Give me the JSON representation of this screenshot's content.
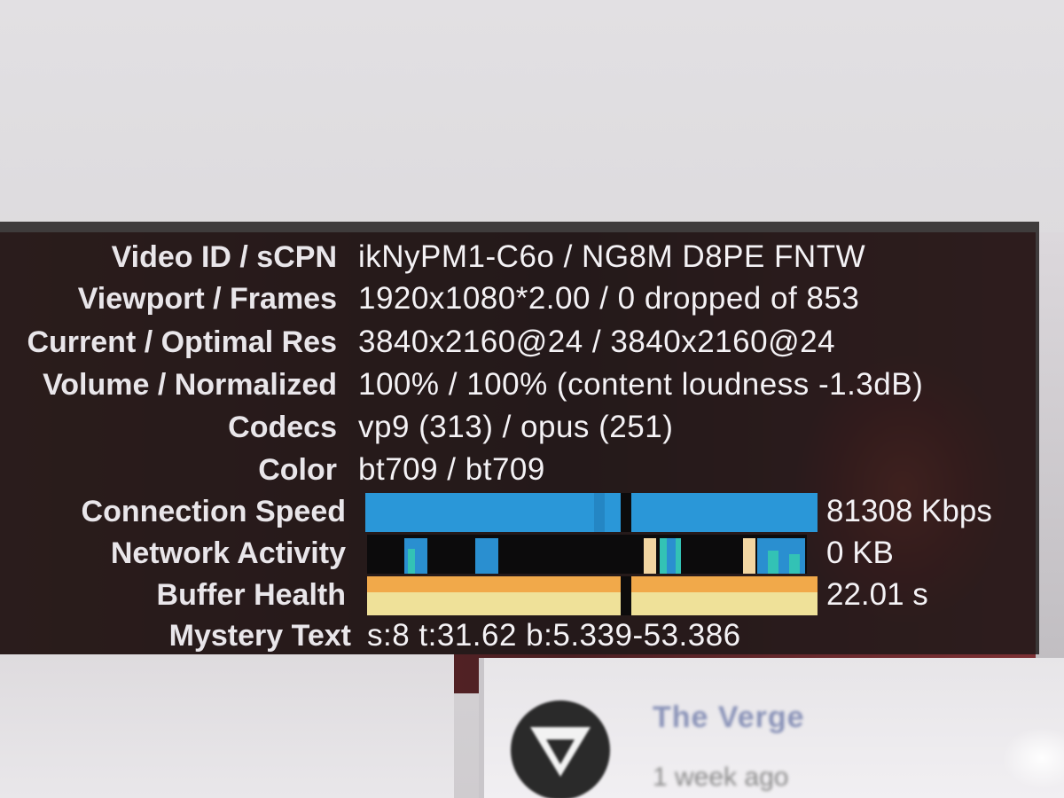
{
  "stats": [
    {
      "label": "Video ID / sCPN",
      "value": "ikNyPM1-C6o / NG8M D8PE FNTW"
    },
    {
      "label": "Viewport / Frames",
      "value": "1920x1080*2.00 / 0 dropped of 853"
    },
    {
      "label": "Current / Optimal Res",
      "value": "3840x2160@24 / 3840x2160@24"
    },
    {
      "label": "Volume / Normalized",
      "value": "100% / 100% (content loudness -1.3dB)"
    },
    {
      "label": "Codecs",
      "value": "vp9 (313) / opus (251)"
    },
    {
      "label": "Color",
      "value": "bt709 / bt709"
    }
  ],
  "graphs": {
    "connection_speed": {
      "label": "Connection Speed",
      "value": "81308 Kbps",
      "color": "#2a97d8"
    },
    "network_activity": {
      "label": "Network Activity",
      "value": "0 KB",
      "colors": [
        "#2a8fd0",
        "#33c2b5",
        "#f2d6a2"
      ]
    },
    "buffer_health": {
      "label": "Buffer Health",
      "value": "22.01 s",
      "colors": [
        "#f1a94a",
        "#efe199"
      ]
    }
  },
  "mystery": {
    "label": "Mystery Text",
    "value": "s:8 t:31.62 b:5.339-53.386"
  },
  "channel": {
    "name": "The Verge",
    "subtitle": "1 week ago"
  }
}
